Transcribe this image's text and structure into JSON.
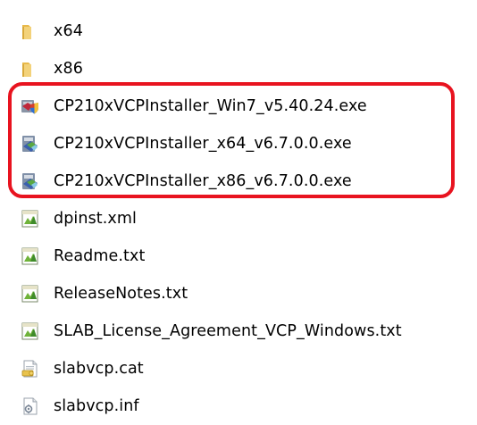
{
  "files": [
    {
      "name": "x64",
      "icon": "folder-icon",
      "type": "folder"
    },
    {
      "name": "x86",
      "icon": "folder-icon",
      "type": "folder"
    },
    {
      "name": "CP210xVCPInstaller_Win7_v5.40.24.exe",
      "icon": "installer-shield-icon",
      "type": "exe"
    },
    {
      "name": "CP210xVCPInstaller_x64_v6.7.0.0.exe",
      "icon": "installer-exe-icon",
      "type": "exe"
    },
    {
      "name": "CP210xVCPInstaller_x86_v6.7.0.0.exe",
      "icon": "installer-exe-icon",
      "type": "exe"
    },
    {
      "name": "dpinst.xml",
      "icon": "text-document-icon",
      "type": "xml"
    },
    {
      "name": "Readme.txt",
      "icon": "text-document-icon",
      "type": "txt"
    },
    {
      "name": "ReleaseNotes.txt",
      "icon": "text-document-icon",
      "type": "txt"
    },
    {
      "name": "SLAB_License_Agreement_VCP_Windows.txt",
      "icon": "text-document-icon",
      "type": "txt"
    },
    {
      "name": "slabvcp.cat",
      "icon": "security-catalog-icon",
      "type": "cat"
    },
    {
      "name": "slabvcp.inf",
      "icon": "setup-info-icon",
      "type": "inf"
    }
  ],
  "highlight": {
    "color": "#e8131f"
  }
}
